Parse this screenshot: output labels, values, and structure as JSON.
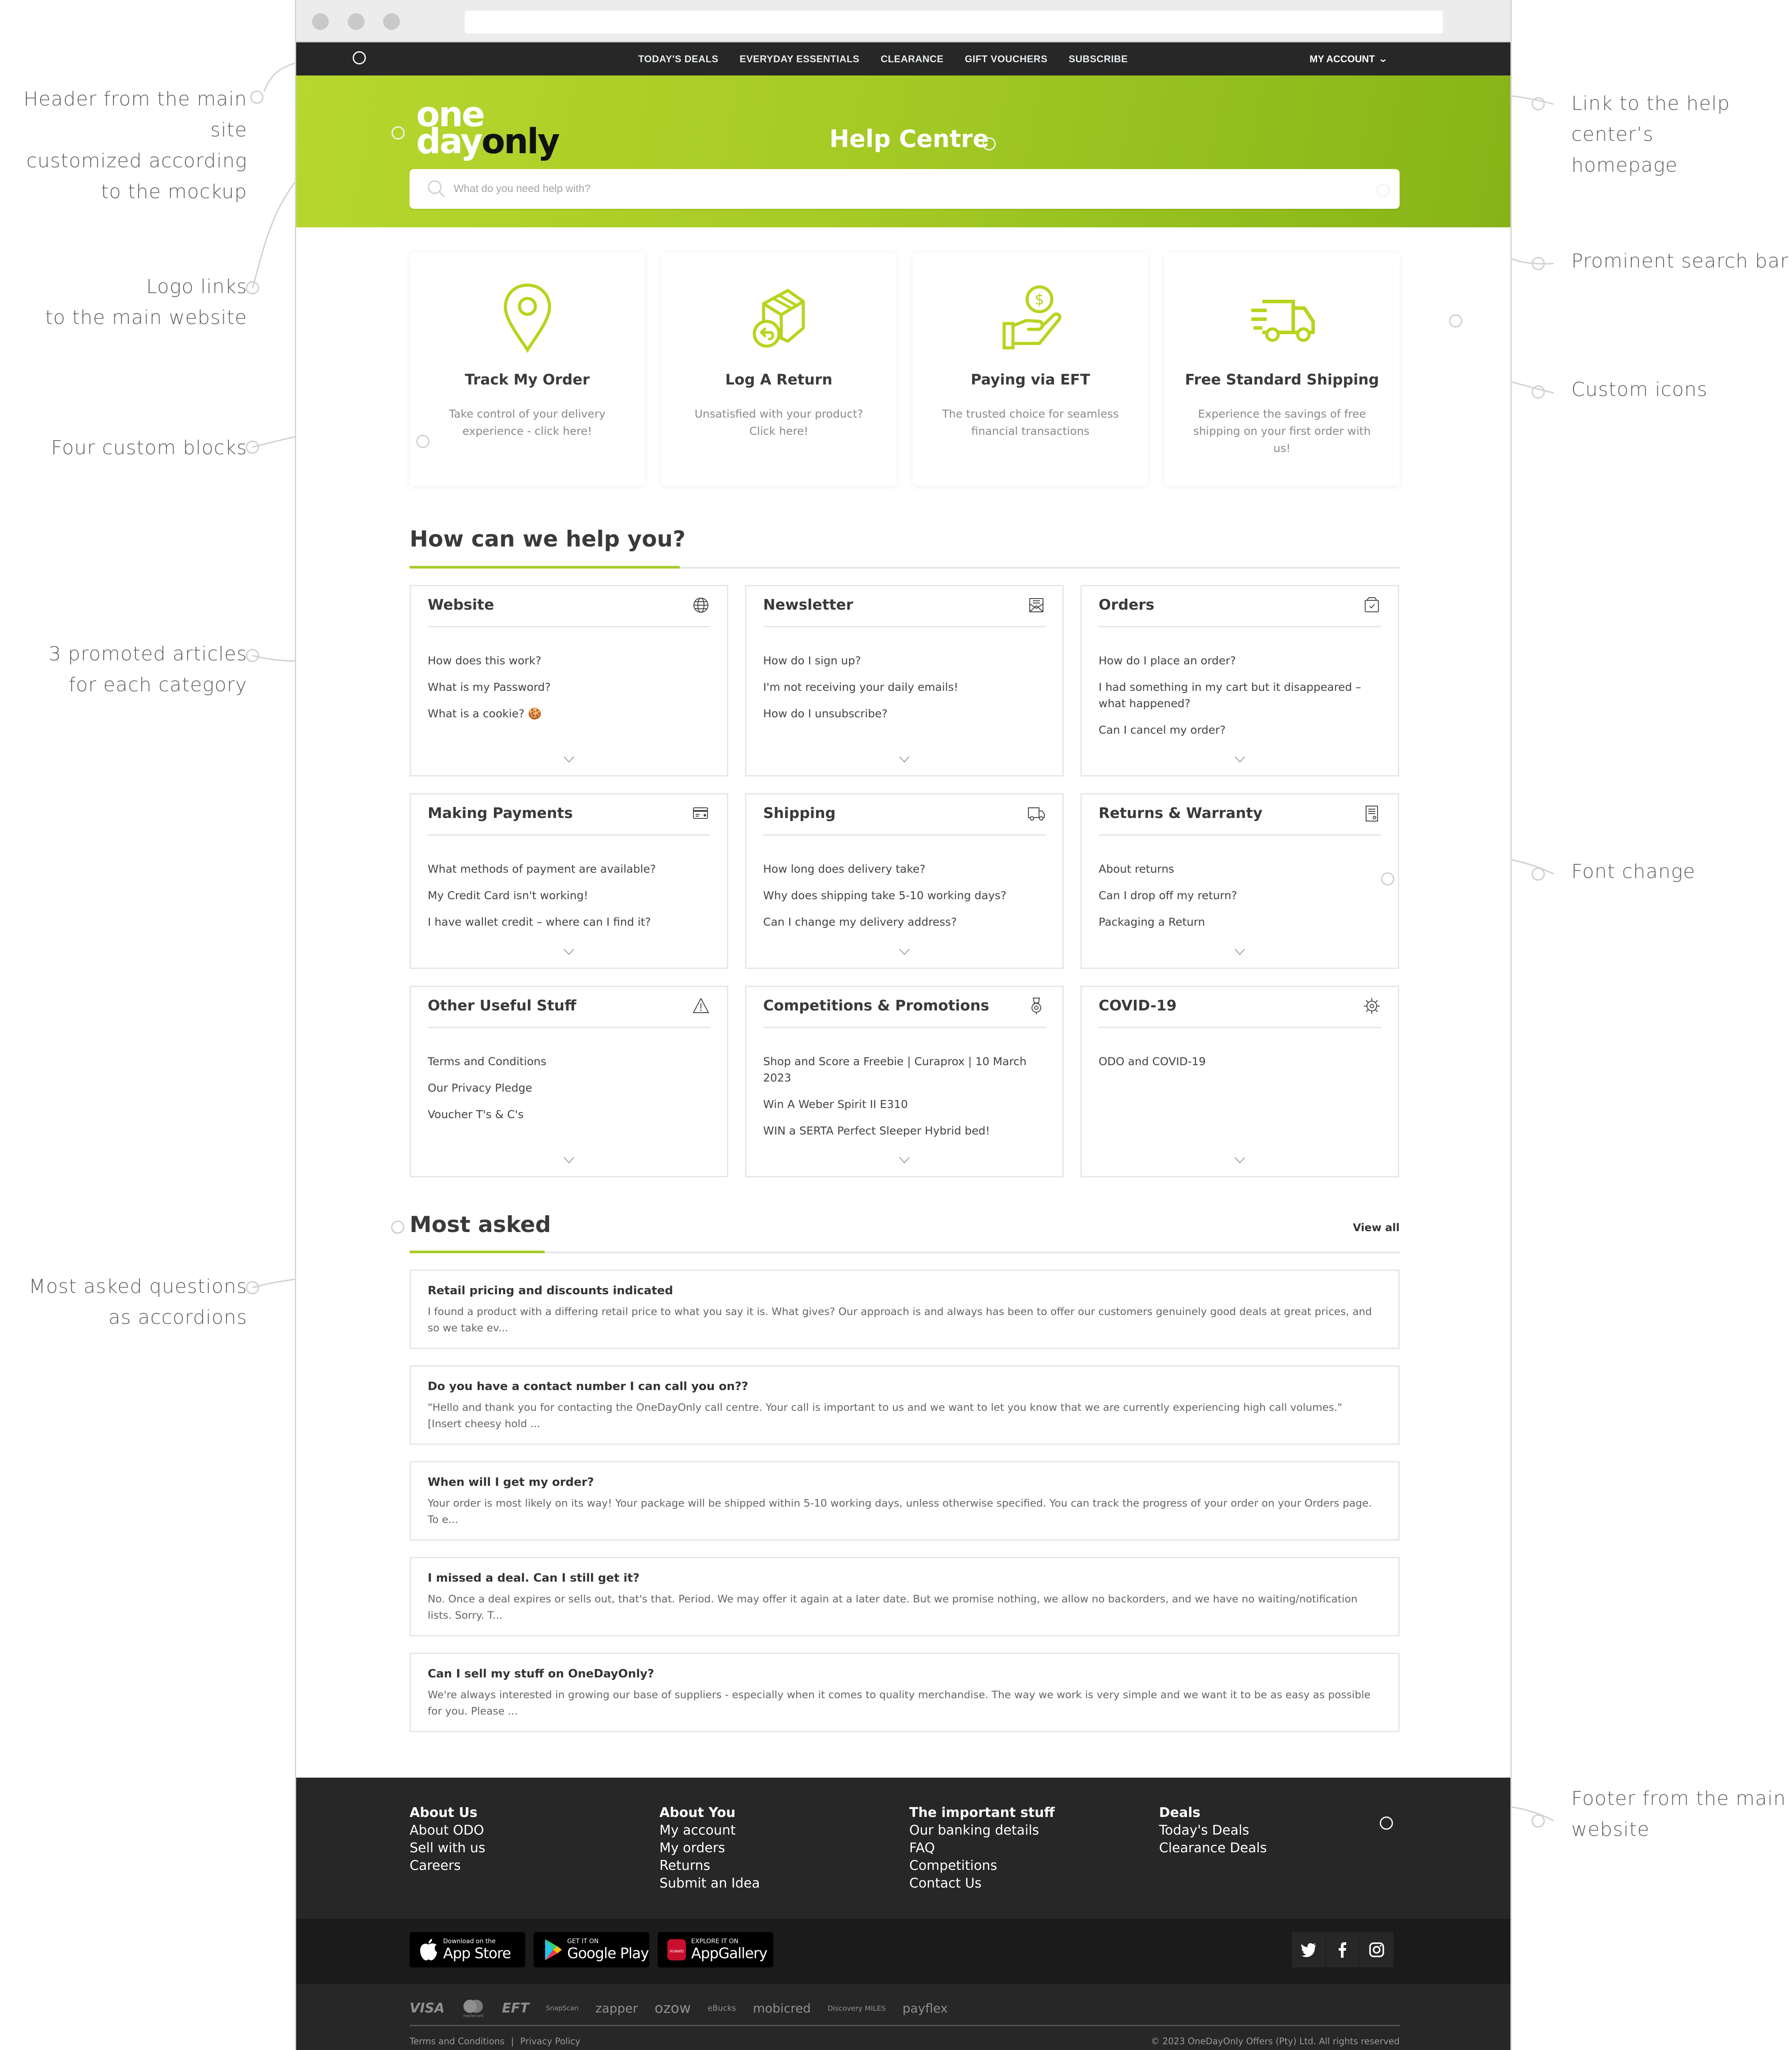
{
  "annotations": {
    "left": [
      {
        "text": "Header from the main site customized according to the mockup",
        "lines": [
          "Header from the main site",
          "customized according",
          "to the mockup"
        ]
      },
      {
        "text": "Logo links to the main website",
        "lines": [
          "Logo links",
          "to the main website"
        ]
      },
      {
        "text": "Four custom blocks",
        "lines": [
          "Four custom blocks"
        ]
      },
      {
        "text": "3 promoted articles for each category",
        "lines": [
          "3 promoted articles",
          "for each category"
        ]
      },
      {
        "text": "Most asked questions as accordions",
        "lines": [
          "Most asked questions",
          "as accordions"
        ]
      }
    ],
    "right": [
      {
        "text": "Link to the help center's homepage",
        "lines": [
          "Link to the help center’s",
          "homepage"
        ]
      },
      {
        "text": "Prominent search bar",
        "lines": [
          "Prominent search bar"
        ]
      },
      {
        "text": "Custom icons",
        "lines": [
          "Custom icons"
        ]
      },
      {
        "text": "Font change",
        "lines": [
          "Font change"
        ]
      },
      {
        "text": "Footer from the main website",
        "lines": [
          "Footer from the main",
          "website"
        ]
      }
    ]
  },
  "nav": {
    "links": [
      "TODAY'S DEALS",
      "EVERYDAY ESSENTIALS",
      "CLEARANCE",
      "GIFT VOUCHERS",
      "SUBSCRIBE"
    ],
    "account_label": "MY ACCOUNT",
    "account_icon": "chevron-down-icon"
  },
  "hero": {
    "logo": {
      "line1": "one",
      "line2_white": "day",
      "line2_dark": "only"
    },
    "title": "Help Centre",
    "search_placeholder": "What do you need help with?",
    "search_value": "",
    "search_icon": "search-icon"
  },
  "colors": {
    "brand_green": "#a6cc2a",
    "nav_bg": "#272727",
    "footer_bg": "#272727"
  },
  "blocks": [
    {
      "icon": "map-pin-icon",
      "title": "Track My Order",
      "desc": "Take control of your delivery experience - click here!"
    },
    {
      "icon": "box-return-icon",
      "title": "Log A Return",
      "desc": "Unsatisfied with your product? Click here!"
    },
    {
      "icon": "hand-coin-icon",
      "title": "Paying via EFT",
      "desc": "The trusted choice for seamless financial transactions"
    },
    {
      "icon": "delivery-truck-icon",
      "title": "Free Standard Shipping",
      "desc": "Experience the savings of free shipping on your first order with us!"
    }
  ],
  "help_section": {
    "title": "How can we help you?",
    "categories": [
      {
        "title": "Website",
        "icon": "globe-icon",
        "items": [
          "How does this work?",
          "What is my Password?",
          "What is a cookie? 🍪"
        ]
      },
      {
        "title": "Newsletter",
        "icon": "envelope-icon",
        "items": [
          "How do I sign up?",
          "I'm not receiving your daily emails!",
          "How do I unsubscribe?"
        ]
      },
      {
        "title": "Orders",
        "icon": "shopping-bag-icon",
        "items": [
          "How do I place an order?",
          "I had something in my cart but it disappeared – what happened?",
          "Can I cancel my order?"
        ]
      },
      {
        "title": "Making Payments",
        "icon": "credit-card-icon",
        "items": [
          "What methods of payment are available?",
          "My Credit Card isn't working!",
          "I have wallet credit – where can I find it?"
        ]
      },
      {
        "title": "Shipping",
        "icon": "truck-icon",
        "items": [
          "How long does delivery take?",
          "Why does shipping take 5-10 working days?",
          "Can I change my delivery address?"
        ]
      },
      {
        "title": "Returns & Warranty",
        "icon": "receipt-icon",
        "items": [
          "About returns",
          "Can I drop off my return?",
          "Packaging a Return"
        ]
      },
      {
        "title": "Other Useful Stuff",
        "icon": "warning-icon",
        "items": [
          "Terms and Conditions",
          "Our Privacy Pledge",
          "Voucher T's & C's"
        ]
      },
      {
        "title": "Competitions & Promotions",
        "icon": "medal-icon",
        "items": [
          "Shop and Score a Freebie | Curaprox | 10 March 2023",
          "Win A Weber Spirit II E310",
          "WIN a SERTA Perfect Sleeper Hybrid bed!"
        ]
      },
      {
        "title": "COVID-19",
        "icon": "virus-icon",
        "items": [
          "ODO and COVID-19"
        ]
      }
    ]
  },
  "most_asked": {
    "title": "Most asked",
    "view_all": "View all",
    "faqs": [
      {
        "q": "Retail pricing and discounts indicated",
        "a": "I found a product with a differing retail price to what you say it is. What gives? Our approach is and always has been to offer our customers genuinely good deals at great prices, and so we take ev..."
      },
      {
        "q": "Do you have a contact number I can call you on??",
        "a": "\"Hello and thank you for contacting the OneDayOnly call centre. Your call is important to us and we want to let you know that we are currently experiencing high call volumes.\" [Insert cheesy hold ..."
      },
      {
        "q": "When will I get my order?",
        "a": "Your order is most likely on its way! Your package will be shipped within 5-10 working days, unless otherwise specified. You can track the progress of your order on your Orders page. To e..."
      },
      {
        "q": "I missed a deal. Can I still get it?",
        "a": "No. Once a deal expires or sells out, that's that. Period. We may offer it again at a later date. But we promise nothing, we allow no backorders, and we have no waiting/notification lists. Sorry. T..."
      },
      {
        "q": "Can I sell my stuff on OneDayOnly?",
        "a": "We're always interested in growing our base of suppliers - especially when it comes to quality merchandise. The way we work is very simple and we want it to be as easy as possible for you. Please ..."
      }
    ]
  },
  "footer": {
    "columns": [
      {
        "heading": "About Us",
        "links": [
          "About ODO",
          "Sell with us",
          "Careers"
        ]
      },
      {
        "heading": "About You",
        "links": [
          "My account",
          "My orders",
          "Returns",
          "Submit an Idea"
        ]
      },
      {
        "heading": "The important stuff",
        "links": [
          "Our banking details",
          "FAQ",
          "Competitions",
          "Contact Us"
        ]
      },
      {
        "heading": "Deals",
        "links": [
          "Today's Deals",
          "Clearance Deals"
        ]
      }
    ],
    "app_badges": [
      {
        "small": "Download on the",
        "big": "App Store",
        "icon": "apple-icon"
      },
      {
        "small": "GET IT ON",
        "big": "Google Play",
        "icon": "google-play-icon"
      },
      {
        "small": "EXPLORE IT ON",
        "big": "AppGallery",
        "icon": "huawei-icon"
      }
    ],
    "social": [
      "twitter-icon",
      "facebook-icon",
      "instagram-icon"
    ],
    "payment_methods": [
      "VISA",
      "mastercard",
      "EFT",
      "SnapScan",
      "zapper",
      "ozow",
      "eBucks",
      "mobicred",
      "Discovery MILES",
      "payflex"
    ],
    "legal_links": [
      "Terms and Conditions",
      "Privacy Policy"
    ],
    "legal_separator": "|",
    "copyright": "© 2023 OneDayOnly Offers (Pty) Ltd. All rights reserved"
  }
}
